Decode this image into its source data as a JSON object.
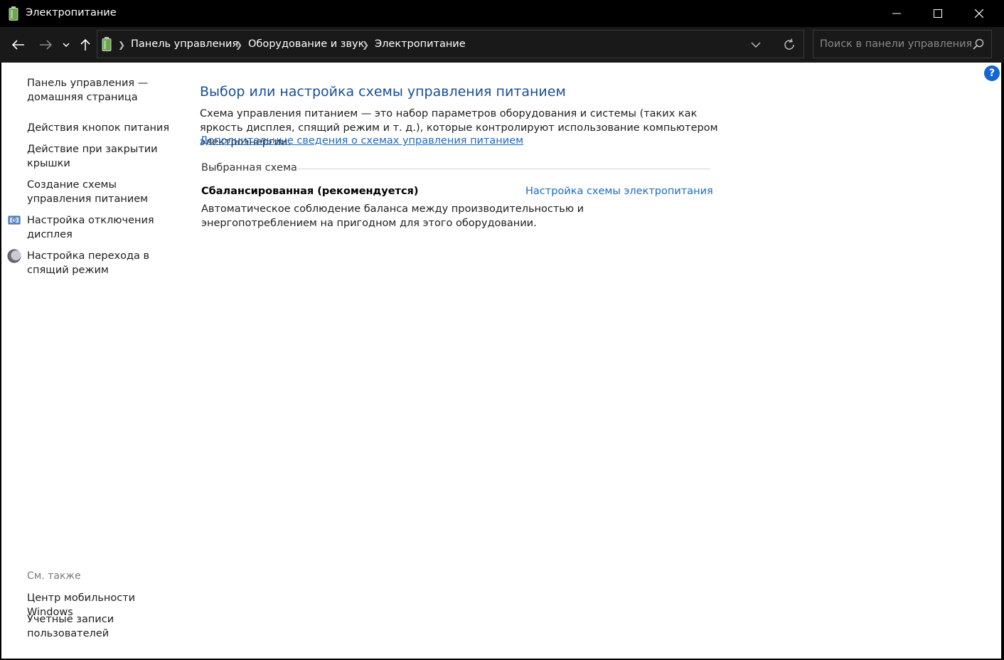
{
  "window": {
    "title": "Электропитание",
    "controls": [
      "minimize-icon",
      "maximize-icon",
      "close-icon"
    ]
  },
  "nav": {
    "breadcrumbs": [
      "Панель управления",
      "Оборудование и звук",
      "Электропитание"
    ],
    "search_placeholder": "Поиск в панели управления"
  },
  "sidebar": {
    "home": "Панель управления — домашняя страница",
    "links": [
      {
        "label": "Действия кнопок питания",
        "icon": null
      },
      {
        "label": "Действие при закрытии крышки",
        "icon": null
      },
      {
        "label": "Создание схемы управления питанием",
        "icon": null
      },
      {
        "label": "Настройка отключения дисплея",
        "icon": "display-power-icon"
      },
      {
        "label": "Настройка перехода в спящий режим",
        "icon": "sleep-moon-icon"
      }
    ],
    "see_also_title": "См. также",
    "see_also": [
      "Центр мобильности Windows",
      "Учетные записи пользователей"
    ]
  },
  "main": {
    "title": "Выбор или настройка схемы управления питанием",
    "description": "Схема управления питанием — это набор параметров оборудования и системы (таких как яркость дисплея, спящий режим и т. д.), которые контролируют использование компьютером электроэнергии.",
    "more_link": "Дополнительные сведения о схемах управления питанием",
    "group_label": "Выбранная схема",
    "plan": {
      "name": "Сбалансированная (рекомендуется)",
      "config_link": "Настройка схемы электропитания",
      "description": "Автоматическое соблюдение баланса между производительностью и энергопотреблением на пригодном для этого оборудовании."
    }
  },
  "colors": {
    "title_blue": "#1a4f95",
    "link_blue": "#1b6ac6",
    "dark_chrome": "#191919"
  }
}
